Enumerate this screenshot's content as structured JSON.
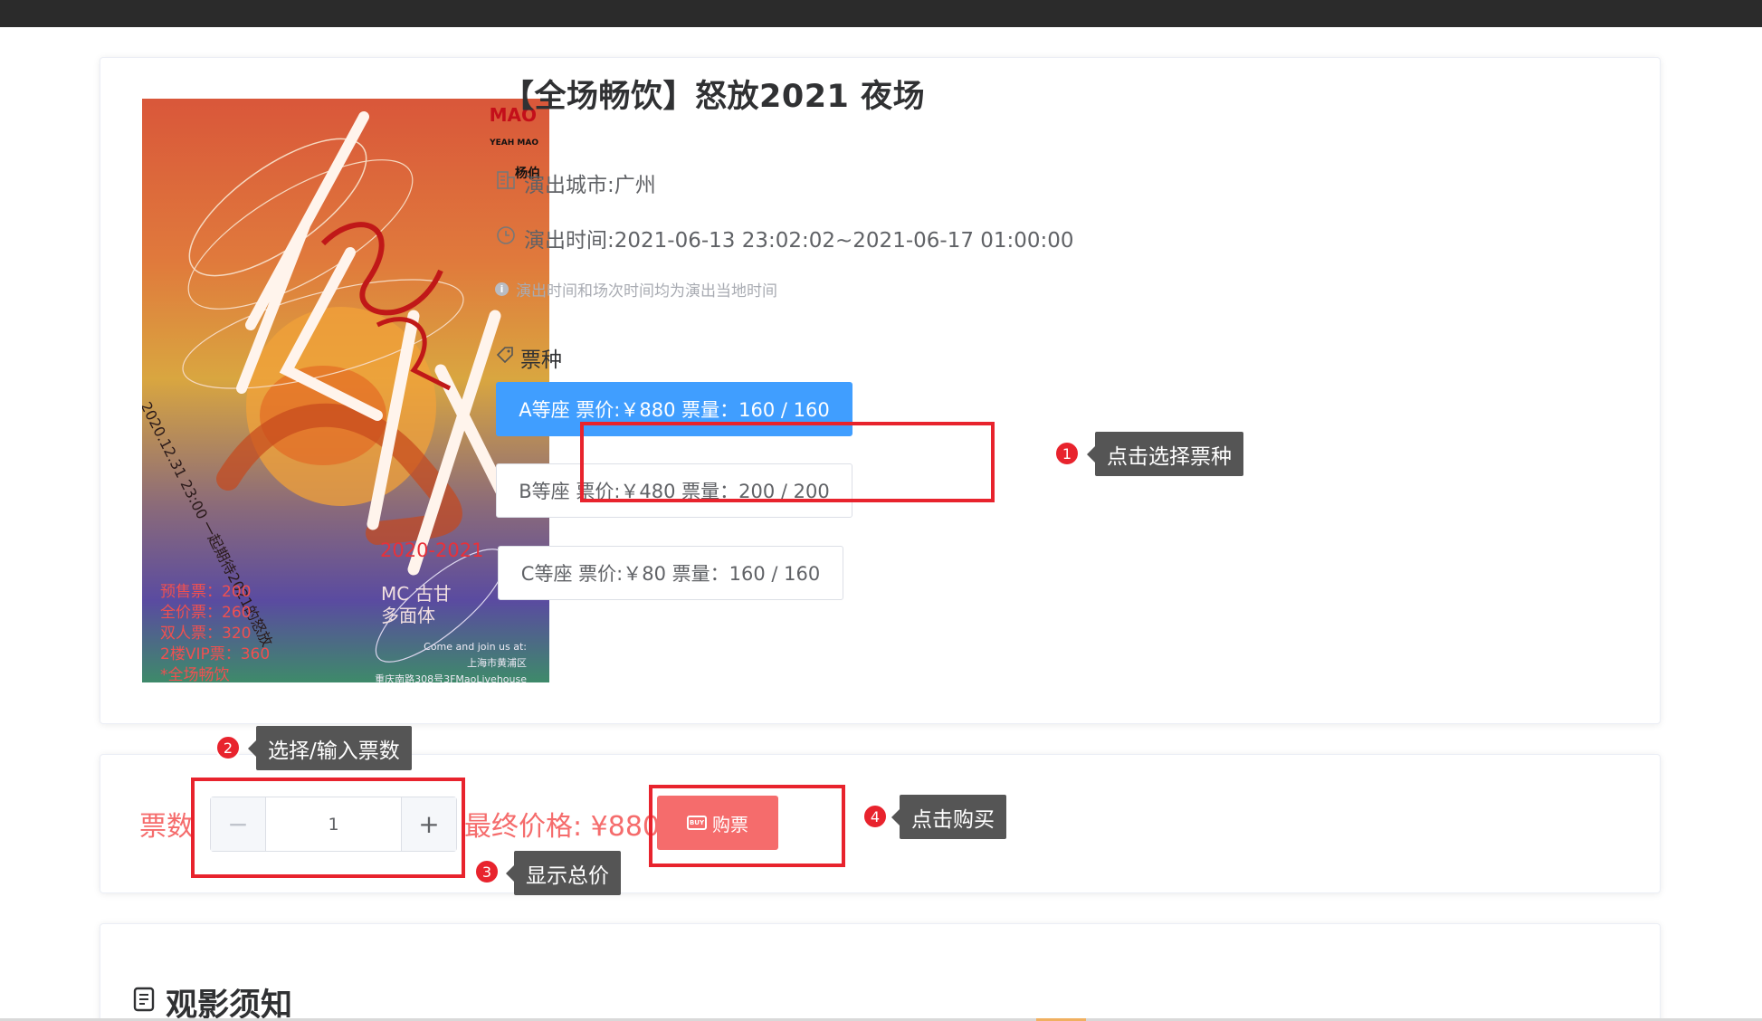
{
  "event": {
    "title": "【全场畅饮】怒放2021 夜场",
    "city": "演出城市:广州",
    "time": "演出时间:2021-06-13 23:02:02~2021-06-17 01:00:00",
    "note": "演出时间和场次时间均为演出当地时间",
    "ticket_kind_label": "票种"
  },
  "poster": {
    "brand": "MAO",
    "brand_sub": "YEAH MAO",
    "brand_cn": "杨伯",
    "arc_text": "2020.12.31 23:00 一起期待2021的怒放",
    "year": "2020-2021",
    "mc_line1": "MC 古甘",
    "mc_line2": "多面体",
    "prices": [
      "预售票：200",
      "全价票：260",
      "双人票：320",
      "2楼VIP票：360",
      "*全场畅饮"
    ],
    "join1": "Come and join us at:",
    "join2": "上海市黄浦区",
    "join3": "重庆南路308号3FMaoLivehouse"
  },
  "tickets": [
    {
      "label": "A等座 票价:￥880 票量：160 / 160",
      "selected": true
    },
    {
      "label": "B等座 票价:￥480 票量：200 / 200",
      "selected": false
    },
    {
      "label": "C等座 票价:￥80 票量：160 / 160",
      "selected": false
    }
  ],
  "buy": {
    "qty_label": "票数",
    "minus": "−",
    "plus": "+",
    "qty_value": "1",
    "final_price": "最终价格: ¥880",
    "buy_label": "购票",
    "buy_icon_text": "BUY"
  },
  "tips": {
    "t1": {
      "num": "1",
      "text": "点击选择票种"
    },
    "t2": {
      "num": "2",
      "text": "选择/输入票数"
    },
    "t3": {
      "num": "3",
      "text": "显示总价"
    },
    "t4": {
      "num": "4",
      "text": "点击购买"
    }
  },
  "notice": {
    "title": "观影须知"
  },
  "colors": {
    "primary": "#409eff",
    "danger": "#f56c6c",
    "highlight_red": "#e8232d",
    "tooltip_bg": "#555555"
  }
}
